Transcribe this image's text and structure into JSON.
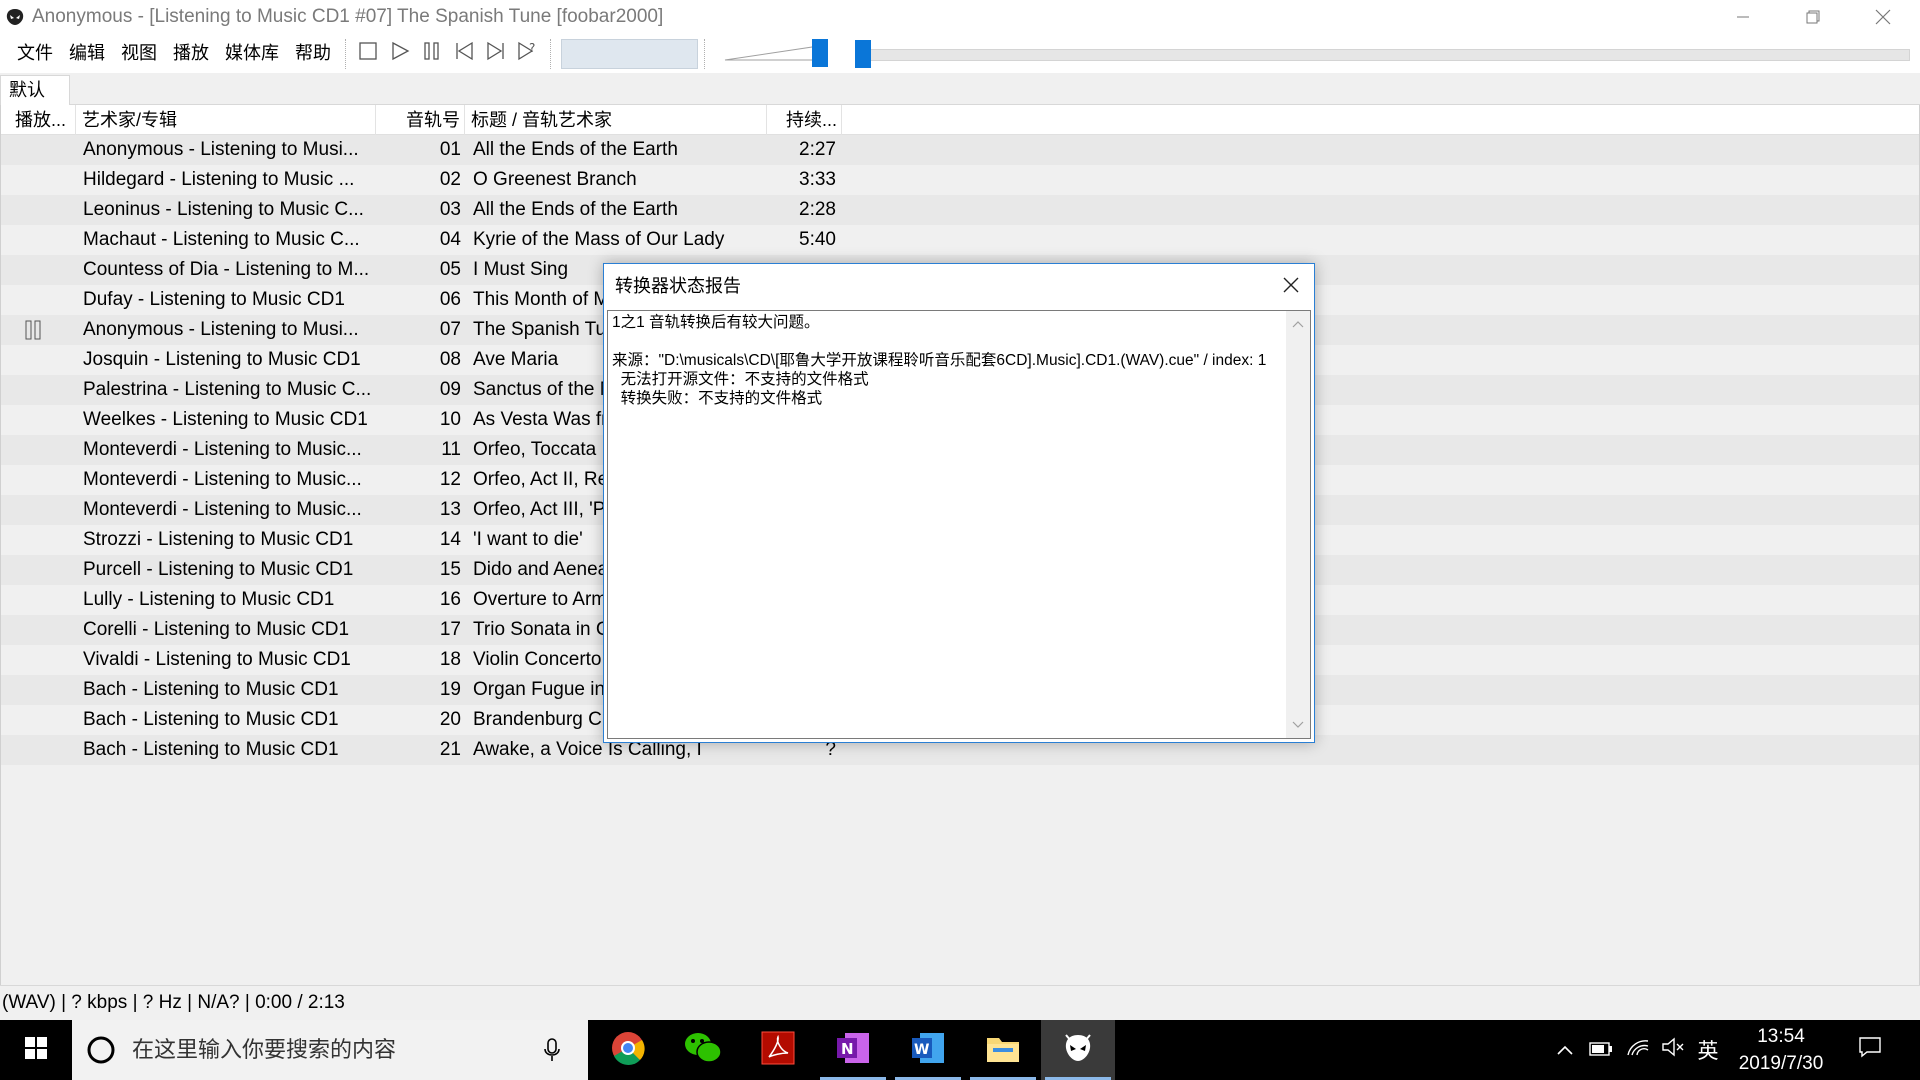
{
  "window": {
    "title": "Anonymous - [Listening to Music CD1 #07] The Spanish Tune  [foobar2000]"
  },
  "menu": [
    "文件",
    "编辑",
    "视图",
    "播放",
    "媒体库",
    "帮助"
  ],
  "tabs": {
    "default": "默认"
  },
  "playlist": {
    "columns": {
      "playing": "播放...",
      "artist_album": "艺术家/专辑",
      "track_no": "音轨号",
      "title_artist": "标题 / 音轨艺术家",
      "duration": "持续..."
    },
    "rows": [
      {
        "artist": "Anonymous - Listening to Musi...",
        "no": "01",
        "title": "All the Ends of the Earth",
        "dur": "2:27"
      },
      {
        "artist": "Hildegard - Listening to Music ...",
        "no": "02",
        "title": "O Greenest Branch",
        "dur": "3:33"
      },
      {
        "artist": "Leoninus - Listening to Music C...",
        "no": "03",
        "title": "All the Ends of the Earth",
        "dur": "2:28"
      },
      {
        "artist": "Machaut - Listening to Music C...",
        "no": "04",
        "title": "Kyrie of the Mass of Our Lady",
        "dur": "5:40"
      },
      {
        "artist": "Countess of Dia - Listening to M...",
        "no": "05",
        "title": "I Must Sing",
        "dur": ""
      },
      {
        "artist": "Dufay - Listening to Music CD1",
        "no": "06",
        "title": "This Month of M",
        "dur": ""
      },
      {
        "artist": "Anonymous - Listening to Musi...",
        "no": "07",
        "title": "The Spanish Tu",
        "dur": ""
      },
      {
        "artist": "Josquin - Listening to Music CD1",
        "no": "08",
        "title": "Ave Maria",
        "dur": ""
      },
      {
        "artist": "Palestrina - Listening to Music C...",
        "no": "09",
        "title": "Sanctus of the M",
        "dur": ""
      },
      {
        "artist": "Weelkes - Listening to Music CD1",
        "no": "10",
        "title": "As Vesta Was fr",
        "dur": ""
      },
      {
        "artist": "Monteverdi - Listening to Music...",
        "no": "11",
        "title": "Orfeo, Toccata",
        "dur": ""
      },
      {
        "artist": "Monteverdi - Listening to Music...",
        "no": "12",
        "title": "Orfeo, Act II, Re",
        "dur": ""
      },
      {
        "artist": "Monteverdi - Listening to Music...",
        "no": "13",
        "title": "Orfeo, Act III, 'P",
        "dur": ""
      },
      {
        "artist": "Strozzi - Listening to Music CD1",
        "no": "14",
        "title": "'I want to die'",
        "dur": ""
      },
      {
        "artist": "Purcell - Listening to Music CD1",
        "no": "15",
        "title": "Dido and Aenea",
        "dur": ""
      },
      {
        "artist": "Lully - Listening to Music CD1",
        "no": "16",
        "title": "Overture to Arm",
        "dur": ""
      },
      {
        "artist": "Corelli - Listening to Music CD1",
        "no": "17",
        "title": "Trio Sonata in C",
        "dur": ""
      },
      {
        "artist": "Vivaldi - Listening to Music CD1",
        "no": "18",
        "title": "Violin Concerto",
        "dur": ""
      },
      {
        "artist": "Bach - Listening to Music CD1",
        "no": "19",
        "title": "Organ Fugue in",
        "dur": ""
      },
      {
        "artist": "Bach - Listening to Music CD1",
        "no": "20",
        "title": "Brandenburg C",
        "dur": ""
      },
      {
        "artist": "Bach - Listening to Music CD1",
        "no": "21",
        "title": "Awake, a Voice Is Calling, I",
        "dur": "?"
      }
    ],
    "playing_row": 7
  },
  "status": "(WAV) | ? kbps | ? Hz | N/A? | 0:00 / 2:13",
  "dialog": {
    "title": "转换器状态报告",
    "text": "1之1 音轨转换后有较大问题。\n\n来源：\"D:\\musicals\\CD\\[耶鲁大学开放课程聆听音乐配套6CD].Music].CD1.(WAV).cue\" / index: 1\n  无法打开源文件：不支持的文件格式\n  转换失败：不支持的文件格式"
  },
  "taskbar": {
    "search_placeholder": "在这里输入你要搜索的内容",
    "ime": "英",
    "time": "13:54",
    "date": "2019/7/30"
  },
  "colors": {
    "accent": "#0a76d8",
    "selection_border": "#2a7fd4"
  }
}
